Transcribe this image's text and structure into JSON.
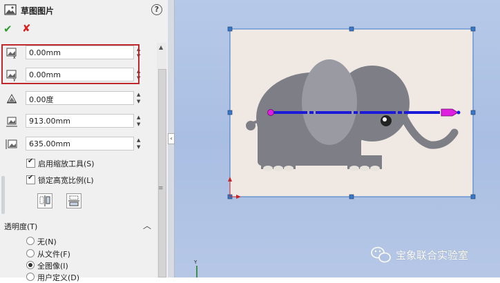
{
  "panel": {
    "title": "草图图片",
    "help": "?",
    "ok": "✔",
    "cancel": "✘"
  },
  "fields": {
    "x_position": "0.00mm",
    "y_position": "0.00mm",
    "angle": "0.00度",
    "width": "913.00mm",
    "height": "635.00mm"
  },
  "checkboxes": {
    "enable_scale_tool": "启用缩放工具(S)",
    "lock_aspect_ratio": "锁定高宽比例(L)"
  },
  "transparency": {
    "section_label": "透明度(T)",
    "options": [
      "无(N)",
      "从文件(F)",
      "全图像(I)",
      "用户定义(D)"
    ],
    "selected": "全图像(I)"
  },
  "canvas": {
    "watermark": "宝象联合实验室",
    "axis_label": "Y"
  },
  "colors": {
    "selection_box": "#3a78c8",
    "highlight": "#c0282c",
    "direction_line": "#1a1ad8",
    "direction_arrow": "#e01ee0"
  }
}
